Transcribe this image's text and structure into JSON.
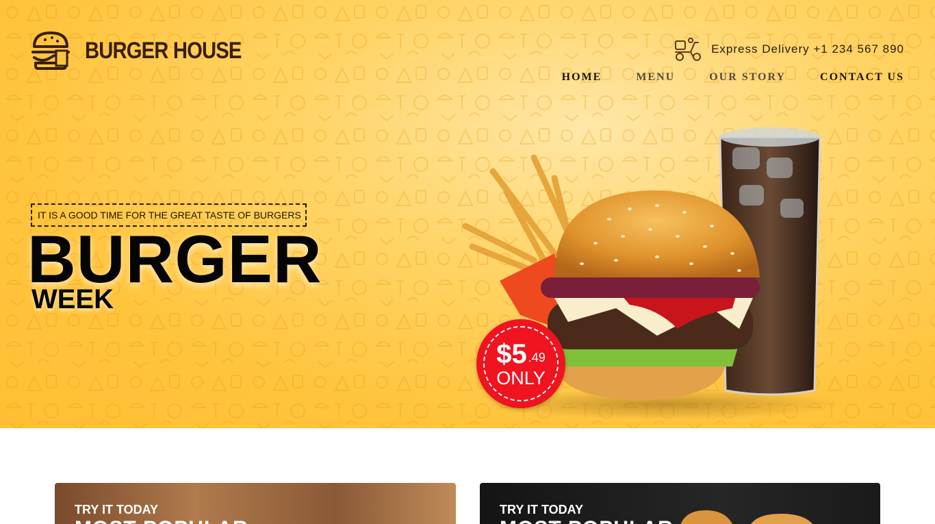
{
  "brand": {
    "name": "BURGER HOUSE",
    "logo_icon": "burger-logo-icon"
  },
  "header": {
    "delivery_text": "Express Delivery +1 234 567 890",
    "delivery_icon": "delivery-scooter-icon"
  },
  "nav": {
    "items": [
      {
        "label": "HOME"
      },
      {
        "label": "MENU"
      },
      {
        "label": "OUR STORY"
      },
      {
        "label": "CONTACT US"
      }
    ]
  },
  "hero": {
    "tagline": "IT IS A GOOD TIME FOR THE GREAT TASTE OF BURGERS",
    "headline": "BURGER",
    "subheadline": "WEEK",
    "price": {
      "main": "$5",
      "cents": ".49",
      "suffix": "ONLY"
    }
  },
  "cards": [
    {
      "eyebrow": "TRY IT TODAY",
      "title": "MOST POPULAR"
    },
    {
      "eyebrow": "TRY IT TODAY",
      "title": "MOST POPULAR"
    }
  ],
  "colors": {
    "hero_background": "#ffc43d",
    "brand_text": "#3a1f0f",
    "badge_red": "#ef1420"
  }
}
